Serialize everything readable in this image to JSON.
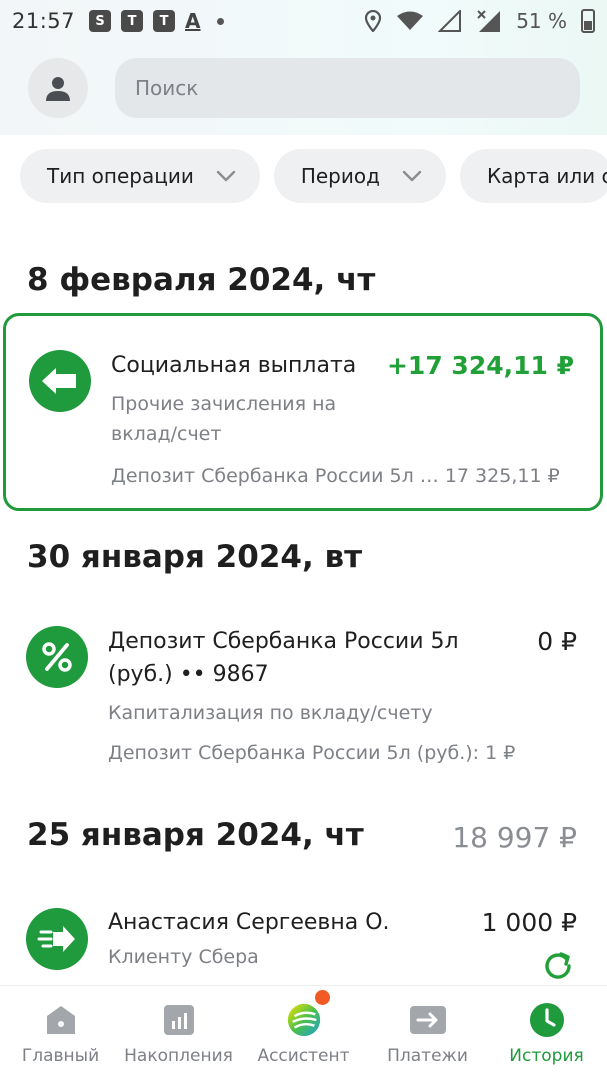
{
  "statusbar": {
    "time": "21:57",
    "battery": "51 %",
    "icons": [
      "sync-icon",
      "shield-icon",
      "shield-icon",
      "a-icon",
      "dot-icon",
      "location-icon",
      "wifi-icon",
      "signal-icon",
      "signal-x-icon",
      "battery-icon"
    ]
  },
  "search": {
    "placeholder": "Поиск"
  },
  "filters": [
    {
      "label": "Тип операции"
    },
    {
      "label": "Период"
    },
    {
      "label": "Карта или с"
    }
  ],
  "groups": [
    {
      "date": "8 февраля 2024, чт",
      "total": "",
      "operations": [
        {
          "icon": "arrow-left-icon",
          "title": "Социальная выплата",
          "subtitle_lines": [
            "Прочие зачисления на",
            "вклад/счет"
          ],
          "amount": "+17 324,11 ₽",
          "detail": "Депозит Сбербанка России 5л … 17 325,11 ₽"
        }
      ]
    },
    {
      "date": "30 января 2024, вт",
      "total": "",
      "operations": [
        {
          "icon": "percent-icon",
          "title_lines": [
            "Депозит Сбербанка России 5л",
            "(руб.) •• 9867"
          ],
          "subtitle": "Капитализация по вкладу/счету",
          "amount": "0 ₽",
          "detail": "Депозит Сбербанка России 5л (руб.): 1 ₽"
        }
      ]
    },
    {
      "date": "25 января 2024, чт",
      "total": "18 997 ₽",
      "operations": [
        {
          "icon": "transfer-arrow-icon",
          "title": "Анастасия Сергеевна О.",
          "subtitle": "Клиенту Сбера",
          "amount": "1 000 ₽",
          "action_icon": "repeat-icon"
        }
      ]
    }
  ],
  "nav": [
    {
      "label": "Главный",
      "icon": "home-icon"
    },
    {
      "label": "Накопления",
      "icon": "savings-chart-icon"
    },
    {
      "label": "Ассистент",
      "icon": "assistant-logo-icon"
    },
    {
      "label": "Платежи",
      "icon": "payments-icon"
    },
    {
      "label": "История",
      "icon": "clock-icon",
      "active": true
    }
  ],
  "colors": {
    "accent_green": "#1f9a3c",
    "amount_green": "#21a038",
    "notification_orange": "#f15a24"
  }
}
